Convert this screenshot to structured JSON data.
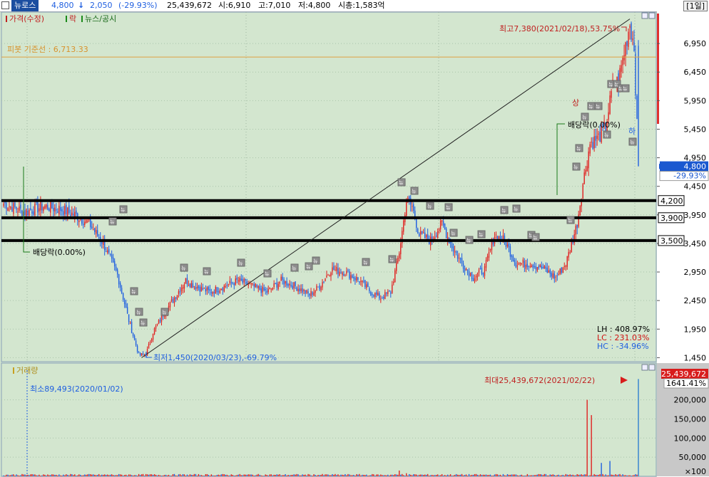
{
  "header": {
    "stock_name": "뉴로스",
    "price": "4,800",
    "change_arrow": "arrow-down-icon",
    "change": "2,050",
    "change_pct": "(-29.93%)",
    "volume": "25,439,672",
    "open": "시:6,910",
    "high": "고:7,010",
    "low": "저:4,800",
    "market_cap": "시총:1,583억",
    "period": "[1일]"
  },
  "legend": {
    "price": "가격(수정)",
    "fall": "락",
    "news": "뉴스/공시",
    "volume": "거래량"
  },
  "annotations": {
    "pivot": "피봇 기준선 : 6,713.33",
    "high": "최고7,380(2021/02/18),53.75%",
    "low": "최저1,450(2020/03/23),-69.79%",
    "dividend1": "배당락(0.00%)",
    "dividend2": "배당락(0.00%)",
    "up": "상",
    "down": "하",
    "news_mark": "뉴",
    "LH": "LH :  408.97%",
    "LC": "LC :  231.03%",
    "HC": "HC :  -34.96%",
    "vol_min": "최소89,493(2020/01/02)",
    "vol_max": "최대25,439,672(2021/02/22)",
    "vol_current": "25,439,672",
    "vol_pct": "1641.41%",
    "price_current": "4,800",
    "price_pct": "-29.93%",
    "vol_unit": "×100"
  },
  "levels": {
    "upper": "4,200",
    "middle": "3,900",
    "lower": "3,500"
  },
  "colors": {
    "background": "#d3e6cf",
    "up_candle": "#e02020",
    "down_candle": "#1f5fe0",
    "trend_line": "#202020",
    "pivot_line": "#e0a040",
    "level_line": "#000000",
    "price_badge": "#1a58d0",
    "volume_badge": "#d81c1c"
  },
  "chart_data": {
    "type": "candlestick",
    "title": "",
    "price_axis": {
      "ticks": [
        6950,
        6450,
        5950,
        5450,
        4950,
        4450,
        3950,
        3450,
        2950,
        2450,
        1950,
        1450
      ],
      "tick_labels": [
        "6,950",
        "6,450",
        "5,950",
        "5,450",
        "4,950",
        "4,450",
        "3,950",
        "3,450",
        "2,950",
        "2,450",
        "1,950",
        "1,450"
      ],
      "range": [
        1380,
        7500
      ]
    },
    "volume_axis": {
      "ticks": [
        200000,
        150000,
        100000,
        50000
      ],
      "tick_labels": [
        "200,000",
        "150,000",
        "100,000",
        "50,000"
      ],
      "unit": "×100"
    },
    "highest": {
      "value": 7380,
      "date": "2021/02/18"
    },
    "lowest": {
      "value": 1450,
      "date": "2020/03/23"
    },
    "pivot": 6713.33,
    "levels": [
      4200,
      3900,
      3500
    ],
    "last": {
      "open": 6910,
      "high": 7010,
      "low": 4800,
      "close": 4800,
      "volume": 25439672
    },
    "max_volume": {
      "value": 25439672,
      "date": "2021/02/22"
    },
    "min_volume": {
      "value": 89493,
      "date": "2020/01/02"
    },
    "anchors": [
      [
        0,
        4150
      ],
      [
        15,
        4000
      ],
      [
        28,
        4100
      ],
      [
        40,
        4050
      ],
      [
        50,
        3950
      ],
      [
        60,
        3800
      ],
      [
        70,
        3450
      ],
      [
        80,
        2900
      ],
      [
        88,
        2100
      ],
      [
        95,
        1500
      ],
      [
        100,
        1500
      ],
      [
        105,
        1900
      ],
      [
        112,
        2200
      ],
      [
        120,
        2500
      ],
      [
        128,
        2800
      ],
      [
        135,
        2700
      ],
      [
        145,
        2600
      ],
      [
        155,
        2700
      ],
      [
        165,
        2800
      ],
      [
        175,
        2700
      ],
      [
        185,
        2600
      ],
      [
        195,
        2800
      ],
      [
        205,
        2700
      ],
      [
        215,
        2550
      ],
      [
        222,
        2700
      ],
      [
        230,
        3000
      ],
      [
        240,
        2950
      ],
      [
        250,
        2800
      ],
      [
        258,
        2600
      ],
      [
        265,
        2500
      ],
      [
        272,
        2600
      ],
      [
        278,
        3300
      ],
      [
        283,
        4200
      ],
      [
        287,
        4100
      ],
      [
        292,
        3600
      ],
      [
        300,
        3500
      ],
      [
        308,
        3800
      ],
      [
        315,
        3400
      ],
      [
        322,
        3100
      ],
      [
        330,
        2850
      ],
      [
        338,
        3000
      ],
      [
        345,
        3600
      ],
      [
        352,
        3500
      ],
      [
        360,
        3100
      ],
      [
        370,
        3100
      ],
      [
        380,
        3000
      ],
      [
        388,
        2850
      ],
      [
        395,
        3100
      ],
      [
        398,
        3350
      ],
      [
        403,
        3800
      ],
      [
        407,
        4500
      ],
      [
        412,
        5200
      ],
      [
        418,
        5300
      ],
      [
        423,
        5500
      ],
      [
        428,
        6200
      ],
      [
        432,
        6300
      ],
      [
        436,
        6800
      ],
      [
        440,
        7300
      ],
      [
        443,
        6900
      ],
      [
        446,
        4800
      ]
    ],
    "volume_spikes": [
      [
        278,
        15000
      ],
      [
        280,
        6000
      ],
      [
        283,
        8000
      ],
      [
        286,
        4000
      ],
      [
        410,
        200000
      ],
      [
        413,
        160000
      ],
      [
        420,
        35000
      ],
      [
        426,
        40000
      ],
      [
        446,
        254397
      ]
    ]
  }
}
